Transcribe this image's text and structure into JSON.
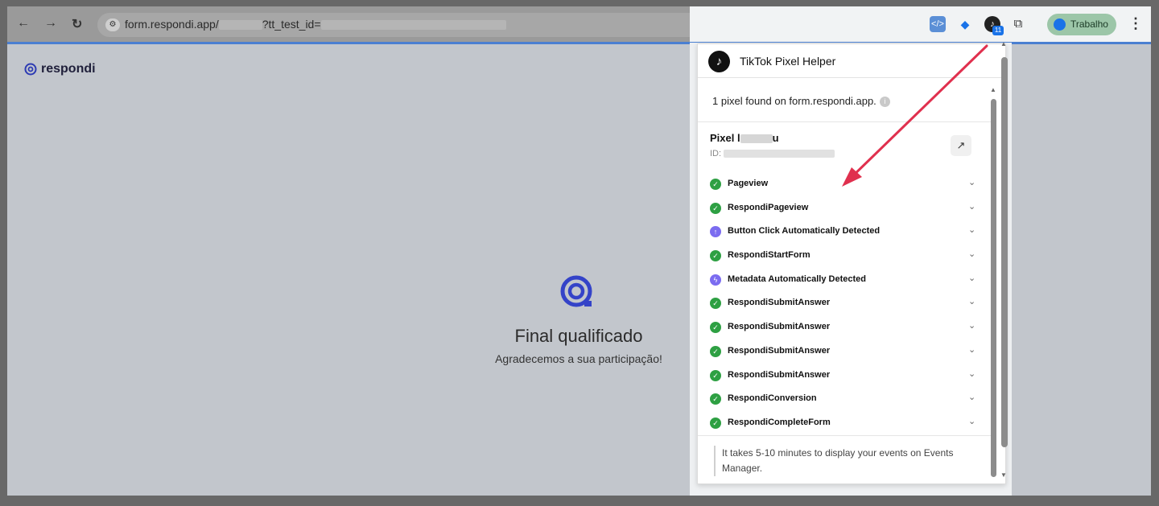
{
  "browser": {
    "url_host": "form.respondi.app/",
    "url_query": "?tt_test_id=",
    "profile_label": "Trabalho",
    "extension_badge": "11"
  },
  "page": {
    "brand": "respondi",
    "final_title": "Final qualificado",
    "final_subtitle": "Agradecemos a sua participação!"
  },
  "popup": {
    "title": "TikTok Pixel Helper",
    "found_text": "1 pixel found on form.respondi.app.",
    "pixel_name_prefix": "Pixel l",
    "pixel_name_suffix": "u",
    "pixel_id_label": "ID:",
    "events": [
      {
        "label": "Pageview",
        "status": "success"
      },
      {
        "label": "RespondiPageview",
        "status": "success"
      },
      {
        "label": "Button Click Automatically Detected",
        "status": "auto"
      },
      {
        "label": "RespondiStartForm",
        "status": "success"
      },
      {
        "label": "Metadata Automatically Detected",
        "status": "auto-meta"
      },
      {
        "label": "RespondiSubmitAnswer",
        "status": "success"
      },
      {
        "label": "RespondiSubmitAnswer",
        "status": "success"
      },
      {
        "label": "RespondiSubmitAnswer",
        "status": "success"
      },
      {
        "label": "RespondiSubmitAnswer",
        "status": "success"
      },
      {
        "label": "RespondiConversion",
        "status": "success"
      },
      {
        "label": "RespondiCompleteForm",
        "status": "success"
      }
    ],
    "note": "It takes 5-10 minutes to display your events on Events Manager."
  },
  "colors": {
    "success": "#2ea043",
    "auto": "#7b6cf0",
    "arrow": "#e0304e"
  }
}
